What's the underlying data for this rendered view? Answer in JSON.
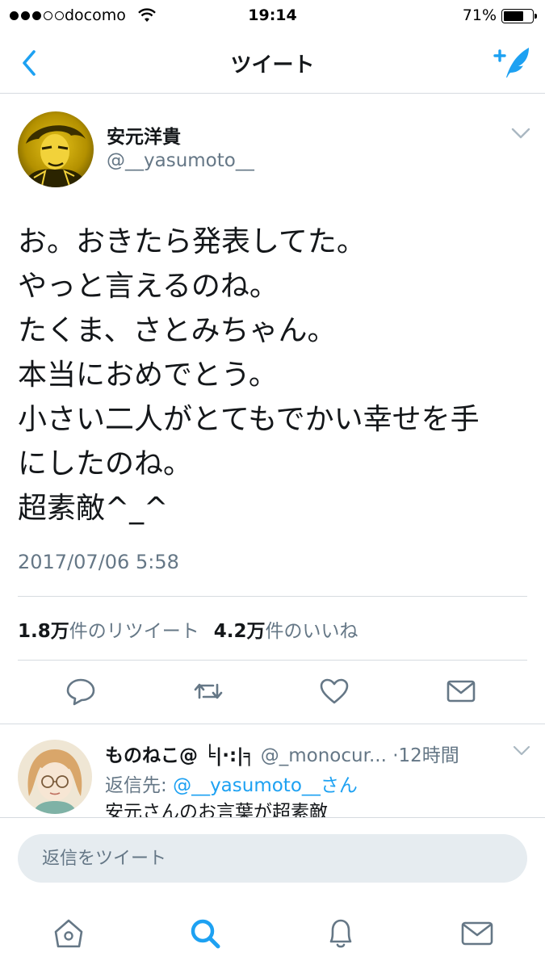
{
  "status_bar": {
    "carrier": "docomo",
    "time": "19:14",
    "battery_percent": "71%",
    "battery_level": 0.71,
    "signal_bars_filled": 3,
    "signal_bars_total": 5
  },
  "nav": {
    "title": "ツイート",
    "back_icon": "chevron-left-icon",
    "compose_icon": "compose-tweet-icon"
  },
  "tweet": {
    "author_name": "安元洋貴",
    "author_handle": "@__yasumoto__",
    "text_lines": [
      "お。おきたら発表してた。",
      "やっと言えるのね。",
      "たくま、さとみちゃん。",
      "本当におめでとう。",
      "小さい二人がとてもでかい幸せを手",
      "にしたのね。",
      "超素敵^_^"
    ],
    "timestamp": "2017/07/06 5:58",
    "retweet_count": "1.8万",
    "retweet_label": "件のリツイート",
    "like_count": "4.2万",
    "like_label": "件のいいね"
  },
  "actions": [
    "reply-icon",
    "retweet-icon",
    "like-icon",
    "direct-message-icon"
  ],
  "reply": {
    "name": "ものねこ@ ╘|·:|╕",
    "handle": "@_monocur...",
    "time": "·12時間",
    "reply_to_label": "返信先: ",
    "reply_to_handle": "@__yasumoto__さん",
    "text": "安元さんのお言葉が超素敵"
  },
  "compose": {
    "placeholder": "返信をツイート"
  },
  "tabs": [
    "home-icon",
    "search-icon",
    "notifications-icon",
    "messages-icon"
  ],
  "colors": {
    "accent": "#1da1f2",
    "secondary_text": "#657786",
    "icon_gray": "#657786",
    "divider": "#d6dbe0"
  }
}
